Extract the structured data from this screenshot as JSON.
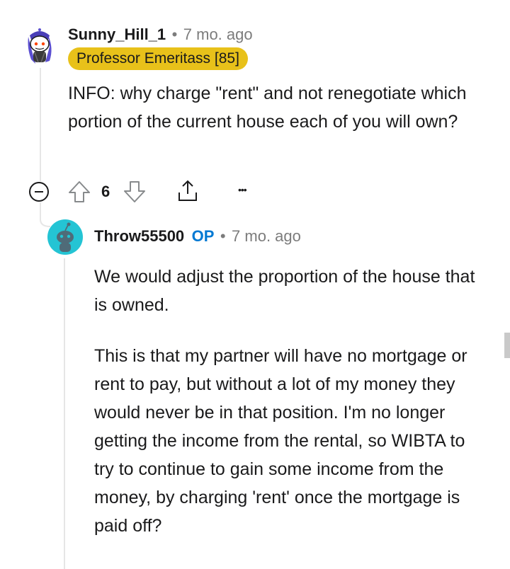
{
  "comment": {
    "username": "Sunny_Hill_1",
    "separator": "•",
    "age": "7 mo. ago",
    "flair": "Professor Emeritass [85]",
    "body": "INFO: why charge \"rent\" and not renegotiate which portion of the current house each of you will own?",
    "vote_count": "6",
    "more_label": "•••"
  },
  "reply": {
    "username": "Throw55500",
    "op_badge": "OP",
    "separator": "•",
    "age": "7 mo. ago",
    "paragraphs": [
      "We would adjust the proportion of the house that is owned.",
      "This is that my partner will have no mortgage or rent to pay, but without a lot of my money they would never be in that position. I'm no longer getting the income from the rental, so WIBTA to try to continue to gain some income from the money, by charging 'rent' once the mortgage is paid off?"
    ]
  },
  "colors": {
    "flair_bg": "#e8c11a",
    "op_blue": "#0079d3",
    "meta_gray": "#7c7c7c",
    "avatar_purple": "#5b4fd1",
    "avatar_teal": "#24c4d4"
  },
  "icons": [
    "snoo-avatar-icon",
    "collapse-icon",
    "upvote-icon",
    "downvote-icon",
    "share-icon",
    "more-options-icon"
  ]
}
